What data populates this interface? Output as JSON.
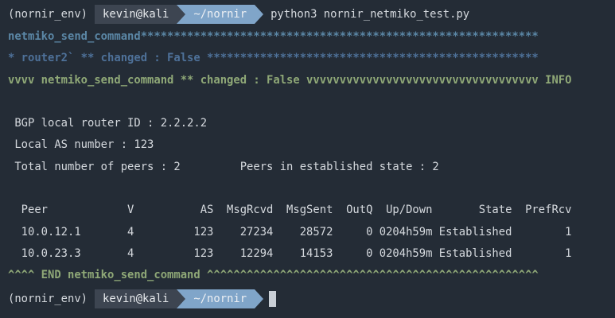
{
  "colors": {
    "background": "#242c36",
    "foreground": "#d5d9de",
    "title_blue": "#5b87a6",
    "host_blue": "#4e7199",
    "green": "#8fa877",
    "segment_user_bg": "#3d4551",
    "segment_user_text": "#e6e9ec",
    "segment_path_bg": "#80a5c9",
    "segment_path_text": "#eceff3",
    "cursor": "#c9cfd6"
  },
  "prompt_top": {
    "venv": "(nornir_env)",
    "user_host": "kevin@kali",
    "path": "~/nornir",
    "command": "python3 nornir_netmiko_test.py"
  },
  "prompt_bottom": {
    "venv": "(nornir_env)",
    "user_host": "kevin@kali",
    "path": "~/nornir"
  },
  "nornir_output": {
    "title_line": "netmiko_send_command************************************************************",
    "host_line": "* router2` ** changed : False **************************************************",
    "task_line": "vvvv netmiko_send_command ** changed : False vvvvvvvvvvvvvvvvvvvvvvvvvvvvvvvvvvv INFO",
    "end_line": "^^^^ END netmiko_send_command ^^^^^^^^^^^^^^^^^^^^^^^^^^^^^^^^^^^^^^^^^^^^^^^^^^"
  },
  "bgp_output": {
    "router_id_line": " BGP local router ID : 2.2.2.2",
    "local_as_line": " Local AS number : 123",
    "peers_summary_line": " Total number of peers : 2         Peers in established state : 2",
    "table_header_line": "  Peer            V          AS  MsgRcvd  MsgSent  OutQ  Up/Down       State  PrefRcv",
    "table_row_lines": [
      "  10.0.12.1       4         123    27234    28572     0 0204h59m Established        1",
      "  10.0.23.3       4         123    12294    14153     0 0204h59m Established        1"
    ],
    "table": {
      "headers": [
        "Peer",
        "V",
        "AS",
        "MsgRcvd",
        "MsgSent",
        "OutQ",
        "Up/Down",
        "State",
        "PrefRcv"
      ],
      "rows": [
        [
          "10.0.12.1",
          "4",
          "123",
          "27234",
          "28572",
          "0",
          "0204h59m",
          "Established",
          "1"
        ],
        [
          "10.0.23.3",
          "4",
          "123",
          "12294",
          "14153",
          "0",
          "0204h59m",
          "Established",
          "1"
        ]
      ]
    }
  }
}
